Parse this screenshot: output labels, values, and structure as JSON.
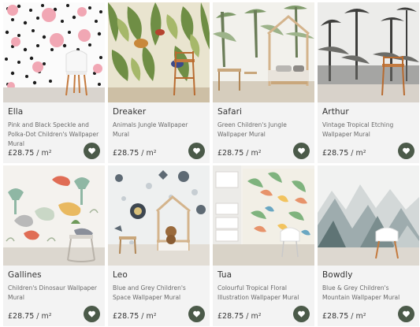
{
  "products": [
    {
      "name": "Ella",
      "description": "Pink and Black Speckle and Polka-Dot Children's Wallpaper Mural",
      "price": "£28.75",
      "unit": "/ m²",
      "favorite_icon": "heart-icon",
      "accent": "#4b5a49"
    },
    {
      "name": "Dreaker",
      "description": "Animals Jungle Wallpaper Mural",
      "price": "£28.75",
      "unit": "/ m²",
      "favorite_icon": "heart-icon",
      "accent": "#4b5a49"
    },
    {
      "name": "Safari",
      "description": "Green Children's Jungle Wallpaper Mural",
      "price": "£28.75",
      "unit": "/ m²",
      "favorite_icon": "heart-icon",
      "accent": "#4b5a49"
    },
    {
      "name": "Arthur",
      "description": "Vintage Tropical Etching Wallpaper Mural",
      "price": "£28.75",
      "unit": "/ m²",
      "favorite_icon": "heart-icon",
      "accent": "#4b5a49"
    },
    {
      "name": "Gallines",
      "description": "Children's Dinosaur Wallpaper Mural",
      "price": "£28.75",
      "unit": "/ m²",
      "favorite_icon": "heart-icon",
      "accent": "#4b5a49"
    },
    {
      "name": "Leo",
      "description": "Blue and Grey Children's Space Wallpaper Mural",
      "price": "£28.75",
      "unit": "/ m²",
      "favorite_icon": "heart-icon",
      "accent": "#4b5a49"
    },
    {
      "name": "Tua",
      "description": "Colourful Tropical Floral Illustration Wallpaper Mural",
      "price": "£28.75",
      "unit": "/ m²",
      "favorite_icon": "heart-icon",
      "accent": "#4b5a49"
    },
    {
      "name": "Bowdly",
      "description": "Blue & Grey Children's Mountain Wallpaper Mural",
      "price": "£28.75",
      "unit": "/ m²",
      "favorite_icon": "heart-icon",
      "accent": "#4b5a49"
    }
  ]
}
